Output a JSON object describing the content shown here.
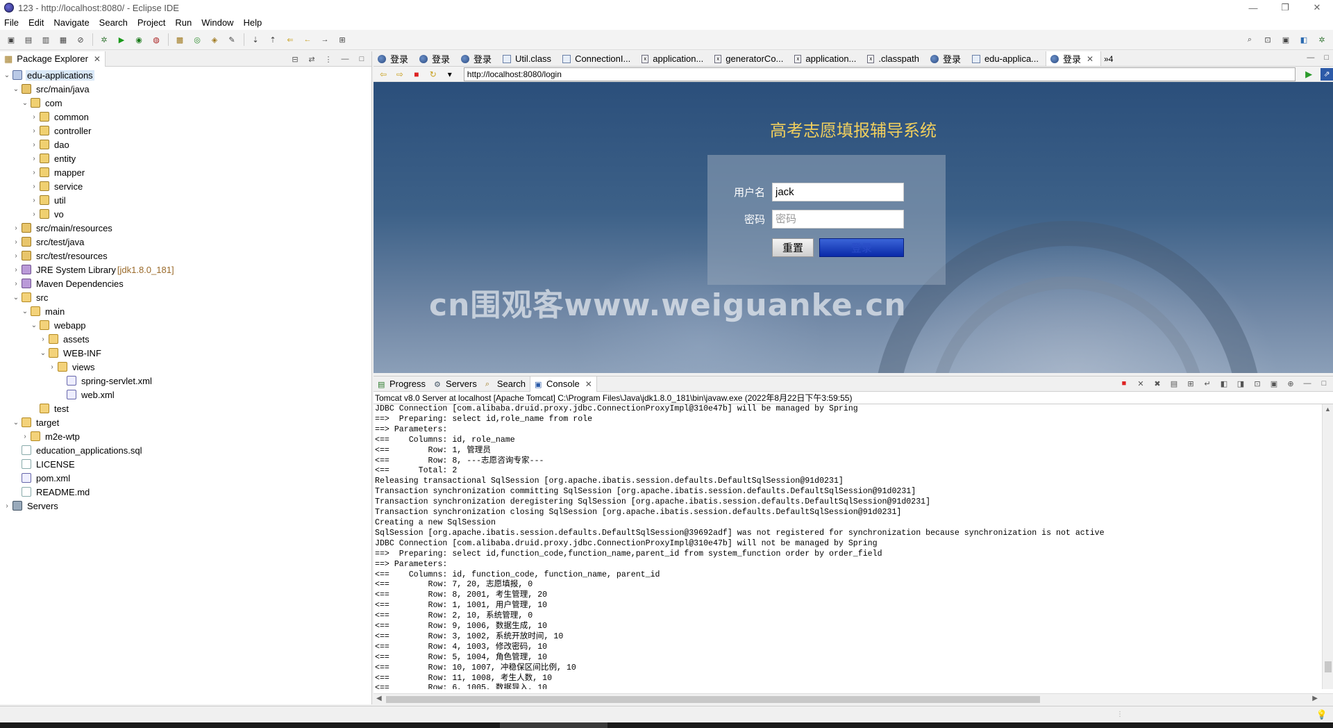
{
  "window": {
    "title": "123 - http://localhost:8080/ - Eclipse IDE",
    "controls": [
      "—",
      "❐",
      "✕"
    ]
  },
  "menu": [
    "File",
    "Edit",
    "Navigate",
    "Search",
    "Project",
    "Run",
    "Window",
    "Help"
  ],
  "package_explorer": {
    "tab_label": "Package Explorer",
    "tree": [
      {
        "label": "edu-applications",
        "indent": 0,
        "twisty": "v",
        "icon": "project",
        "selected": true
      },
      {
        "label": "src/main/java",
        "indent": 1,
        "twisty": "v",
        "icon": "srcfolder"
      },
      {
        "label": "com",
        "indent": 2,
        "twisty": "v",
        "icon": "package"
      },
      {
        "label": "common",
        "indent": 3,
        "twisty": ">",
        "icon": "package"
      },
      {
        "label": "controller",
        "indent": 3,
        "twisty": ">",
        "icon": "package"
      },
      {
        "label": "dao",
        "indent": 3,
        "twisty": ">",
        "icon": "package"
      },
      {
        "label": "entity",
        "indent": 3,
        "twisty": ">",
        "icon": "package"
      },
      {
        "label": "mapper",
        "indent": 3,
        "twisty": ">",
        "icon": "package"
      },
      {
        "label": "service",
        "indent": 3,
        "twisty": ">",
        "icon": "package"
      },
      {
        "label": "util",
        "indent": 3,
        "twisty": ">",
        "icon": "package"
      },
      {
        "label": "vo",
        "indent": 3,
        "twisty": ">",
        "icon": "package"
      },
      {
        "label": "src/main/resources",
        "indent": 1,
        "twisty": ">",
        "icon": "srcfolder"
      },
      {
        "label": "src/test/java",
        "indent": 1,
        "twisty": ">",
        "icon": "srcfolder"
      },
      {
        "label": "src/test/resources",
        "indent": 1,
        "twisty": ">",
        "icon": "srcfolder"
      },
      {
        "label": "JRE System Library",
        "decoration": "[jdk1.8.0_181]",
        "indent": 1,
        "twisty": ">",
        "icon": "lib"
      },
      {
        "label": "Maven Dependencies",
        "indent": 1,
        "twisty": ">",
        "icon": "lib"
      },
      {
        "label": "src",
        "indent": 1,
        "twisty": "v",
        "icon": "folder"
      },
      {
        "label": "main",
        "indent": 2,
        "twisty": "v",
        "icon": "folder"
      },
      {
        "label": "webapp",
        "indent": 3,
        "twisty": "v",
        "icon": "folder"
      },
      {
        "label": "assets",
        "indent": 4,
        "twisty": ">",
        "icon": "folder"
      },
      {
        "label": "WEB-INF",
        "indent": 4,
        "twisty": "v",
        "icon": "folder"
      },
      {
        "label": "views",
        "indent": 5,
        "twisty": ">",
        "icon": "folder"
      },
      {
        "label": "spring-servlet.xml",
        "indent": 6,
        "twisty": "",
        "icon": "xml"
      },
      {
        "label": "web.xml",
        "indent": 6,
        "twisty": "",
        "icon": "xml"
      },
      {
        "label": "test",
        "indent": 3,
        "twisty": "",
        "icon": "folder"
      },
      {
        "label": "target",
        "indent": 1,
        "twisty": "v",
        "icon": "folder"
      },
      {
        "label": "m2e-wtp",
        "indent": 2,
        "twisty": ">",
        "icon": "folder"
      },
      {
        "label": "education_applications.sql",
        "indent": 1,
        "twisty": "",
        "icon": "file"
      },
      {
        "label": "LICENSE",
        "indent": 1,
        "twisty": "",
        "icon": "file"
      },
      {
        "label": "pom.xml",
        "indent": 1,
        "twisty": "",
        "icon": "xml"
      },
      {
        "label": "README.md",
        "indent": 1,
        "twisty": "",
        "icon": "file"
      },
      {
        "label": "Servers",
        "indent": 0,
        "twisty": ">",
        "icon": "servers"
      }
    ]
  },
  "editor_tabs": [
    {
      "label": "登录",
      "icon": "globe"
    },
    {
      "label": "登录",
      "icon": "globe"
    },
    {
      "label": "登录",
      "icon": "globe"
    },
    {
      "label": "Util.class",
      "icon": "class"
    },
    {
      "label": "ConnectionI...",
      "icon": "class"
    },
    {
      "label": "application...",
      "icon": "xml"
    },
    {
      "label": "generatorCo...",
      "icon": "xml"
    },
    {
      "label": "application...",
      "icon": "xml"
    },
    {
      "label": ".classpath",
      "icon": "xml"
    },
    {
      "label": "登录",
      "icon": "globe"
    },
    {
      "label": "edu-applica...",
      "icon": "class"
    },
    {
      "label": "登录",
      "icon": "globe",
      "active": true
    }
  ],
  "editor_overflow": "»4",
  "browser": {
    "url": "http://localhost:8080/login"
  },
  "login_page": {
    "title": "高考志愿填报辅导系统",
    "username_label": "用户名",
    "username_value": "jack",
    "password_label": "密码",
    "password_placeholder": "密码",
    "reset_label": "重置",
    "login_label": "登录",
    "watermark": "cn围观客www.weiguanke.cn"
  },
  "bottom_tabs": [
    {
      "label": "Progress"
    },
    {
      "label": "Servers"
    },
    {
      "label": "Search"
    },
    {
      "label": "Console",
      "active": true
    }
  ],
  "console": {
    "description": "Tomcat v8.0 Server at localhost [Apache Tomcat] C:\\Program Files\\Java\\jdk1.8.0_181\\bin\\javaw.exe  (2022年8月22日下午3:59:55)",
    "lines": [
      "JDBC Connection [com.alibaba.druid.proxy.jdbc.ConnectionProxyImpl@310e47b] will be managed by Spring",
      "==>  Preparing: select id,role_name from role",
      "==> Parameters: ",
      "<==    Columns: id, role_name",
      "<==        Row: 1, 管理员",
      "<==        Row: 8, ---志愿咨询专家---",
      "<==      Total: 2",
      "Releasing transactional SqlSession [org.apache.ibatis.session.defaults.DefaultSqlSession@91d0231]",
      "Transaction synchronization committing SqlSession [org.apache.ibatis.session.defaults.DefaultSqlSession@91d0231]",
      "Transaction synchronization deregistering SqlSession [org.apache.ibatis.session.defaults.DefaultSqlSession@91d0231]",
      "Transaction synchronization closing SqlSession [org.apache.ibatis.session.defaults.DefaultSqlSession@91d0231]",
      "Creating a new SqlSession",
      "SqlSession [org.apache.ibatis.session.defaults.DefaultSqlSession@39692adf] was not registered for synchronization because synchronization is not active",
      "JDBC Connection [com.alibaba.druid.proxy.jdbc.ConnectionProxyImpl@310e47b] will not be managed by Spring",
      "==>  Preparing: select id,function_code,function_name,parent_id from system_function order by order_field",
      "==> Parameters: ",
      "<==    Columns: id, function_code, function_name, parent_id",
      "<==        Row: 7, 20, 志愿填报, 0",
      "<==        Row: 8, 2001, 考生管理, 20",
      "<==        Row: 1, 1001, 用户管理, 10",
      "<==        Row: 2, 10, 系统管理, 0",
      "<==        Row: 9, 1006, 数据生成, 10",
      "<==        Row: 3, 1002, 系统开放时间, 10",
      "<==        Row: 4, 1003, 修改密码, 10",
      "<==        Row: 5, 1004, 角色管理, 10",
      "<==        Row: 10, 1007, 冲稳保区间比例, 10",
      "<==        Row: 11, 1008, 考生人数, 10",
      "<==        Row: 6, 1005, 数据导入, 10"
    ]
  }
}
